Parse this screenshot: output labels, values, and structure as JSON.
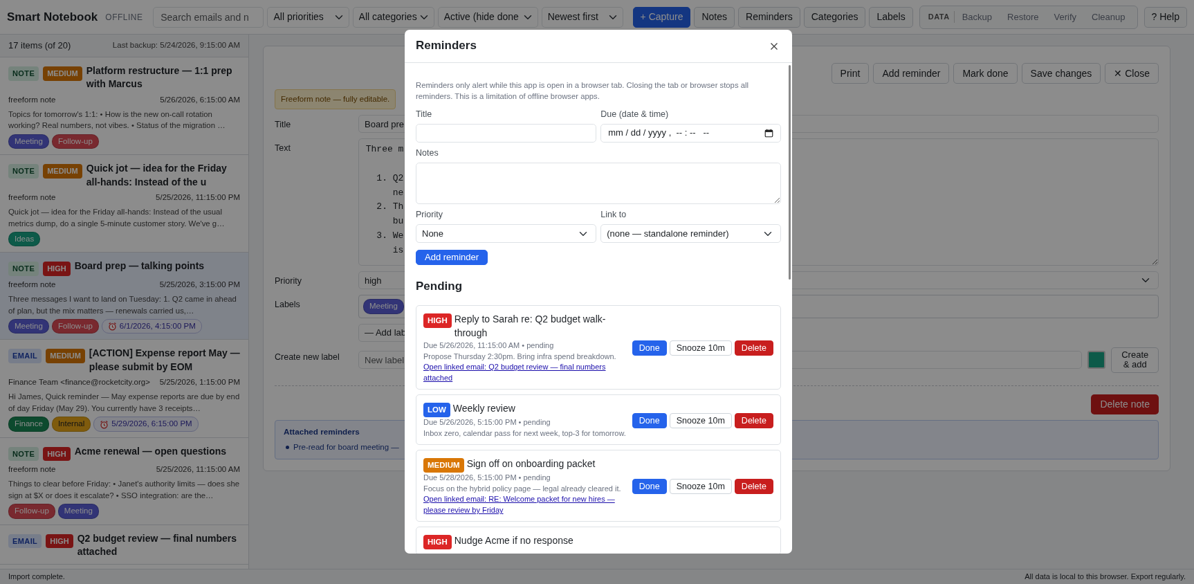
{
  "app": {
    "title": "Smart Notebook",
    "badge": "OFFLINE"
  },
  "toolbar": {
    "search": {
      "placeholder": "Search emails and n"
    },
    "filters": [
      "All priorities",
      "All categories",
      "Active (hide done",
      "Newest first"
    ],
    "buttons": [
      {
        "label": "+ Capture",
        "kind": "primary"
      },
      {
        "label": "Notes",
        "kind": "plain"
      },
      {
        "label": "Reminders",
        "kind": "plain"
      },
      {
        "label": "Categories",
        "kind": "plain"
      },
      {
        "label": "Labels",
        "kind": "plain"
      }
    ],
    "data_group": {
      "label": "DATA",
      "buttons": [
        "Backup",
        "Restore",
        "Verify",
        "Cleanup"
      ]
    },
    "help": "? Help"
  },
  "list": {
    "count": "17 items (of 20)",
    "backup": "Last backup: 5/24/2026, 9:15:00 AM",
    "items": [
      {
        "type": {
          "kind": "note",
          "label": "NOTE"
        },
        "priority": {
          "kind": "medium",
          "label": "MEDIUM"
        },
        "title": "Platform restructure — 1:1 prep with Marcus",
        "source": "freeform note",
        "date": "5/26/2026, 6:15:00 AM",
        "snippet": "Topics for tomorrow's 1:1: • How is the new on-call rotation working? Real numbers, not vibes. • Status of the migration …",
        "tags": [
          {
            "label": "Meeting",
            "color": "#323476"
          },
          {
            "label": "Follow-up",
            "color": "#792930"
          }
        ],
        "selected": false
      },
      {
        "type": {
          "kind": "note",
          "label": "NOTE"
        },
        "priority": {
          "kind": "medium",
          "label": "MEDIUM"
        },
        "title": "Quick jot — idea for the Friday all-hands: Instead of the u",
        "source": "freeform note",
        "date": "5/25/2026, 11:15:00 PM",
        "snippet": "Quick jot — idea for the Friday all-hands: Instead of the usual metrics dump, do a single 5-minute customer story. We've g…",
        "tags": [
          {
            "label": "Ideas",
            "color": "#0e5a49"
          }
        ],
        "selected": false
      },
      {
        "type": {
          "kind": "note",
          "label": "NOTE"
        },
        "priority": {
          "kind": "high",
          "label": "HIGH"
        },
        "title": "Board prep — talking points",
        "source": "freeform note",
        "date": "5/25/2026, 3:15:00 PM",
        "snippet": "Three messages I want to land on Tuesday: 1. Q2 came in ahead of plan, but the mix matters — renewals carried us,…",
        "tags": [
          {
            "label": "Meeting",
            "color": "#323476"
          },
          {
            "label": "Follow-up",
            "color": "#792930"
          }
        ],
        "reminder": "6/1/2026, 4:15:00 PM",
        "selected": true
      },
      {
        "type": {
          "kind": "email",
          "label": "EMAIL"
        },
        "priority": {
          "kind": "medium",
          "label": "MEDIUM"
        },
        "title": "[ACTION] Expense report May — please submit by EOM",
        "source": "Finance Team <finance@rocketcity.org>",
        "date": "5/25/2026, 1:15:00 PM",
        "snippet": "Hi James, Quick reminder — May expense reports are due by end of day Friday (May 29). You currently have 3 receipts…",
        "tags": [
          {
            "label": "Finance",
            "color": "#0e4a2e"
          },
          {
            "label": "Internal",
            "color": "#7f5c0d"
          }
        ],
        "reminder": "5/29/2026, 6:15:00 PM",
        "selected": false
      },
      {
        "type": {
          "kind": "note",
          "label": "NOTE"
        },
        "priority": {
          "kind": "high",
          "label": "HIGH"
        },
        "title": "Acme renewal — open questions",
        "source": "freeform note",
        "date": "5/25/2026, 11:15:00 AM",
        "snippet": "Things to clear before Friday: • Janet's authority limits — does she sign at $X or does it escalate? • SSO integration: are the…",
        "tags": [
          {
            "label": "Follow-up",
            "color": "#792930"
          },
          {
            "label": "Meeting",
            "color": "#323476"
          }
        ],
        "selected": false
      },
      {
        "type": {
          "kind": "email",
          "label": "EMAIL"
        },
        "priority": {
          "kind": "high",
          "label": "HIGH"
        },
        "title": "Q2 budget review — final numbers attached",
        "selected": false
      }
    ]
  },
  "editor": {
    "buttons": [
      "Print",
      "Add reminder",
      "Mark done",
      "Save changes",
      "✕ Close"
    ],
    "notice": "Freeform note — fully editable.",
    "fields": [
      {
        "kind": "input",
        "label": "Title",
        "value": "Board pre"
      },
      {
        "kind": "textarea",
        "label": "Text",
        "value": "Three m\n\n  1. Q2\n     ne\n  2. Th\n     bu\n  3. We\n     is"
      },
      {
        "kind": "select",
        "label": "Priority",
        "value": "high"
      },
      {
        "kind": "labels",
        "label": "Labels",
        "chips": [
          {
            "label": "Meeting",
            "color": "#323476"
          }
        ],
        "add": "— Add lab"
      },
      {
        "kind": "new_label",
        "label": "Create new label",
        "placeholder": "New label",
        "color": "#0e5a49",
        "button": "Create & add"
      }
    ],
    "delete": "Delete note",
    "attached": {
      "title": "Attached reminders",
      "items": [
        "Pre-read for board meeting —"
      ]
    }
  },
  "modal": {
    "title": "Reminders",
    "note": "Reminders only alert while this app is open in a browser tab. Closing the tab or browser stops all reminders. This is a limitation of offline browser apps.",
    "form": {
      "title_label": "Title",
      "due_label": "Due (date & time)",
      "due_placeholder": "mm / dd / yyyy ,  -- : --   --",
      "notes_label": "Notes",
      "priority_label": "Priority",
      "priority_value": "None",
      "link_label": "Link to",
      "link_value": "(none — standalone reminder)",
      "submit": "Add reminder"
    },
    "section": "Pending",
    "reminders": [
      {
        "priority": {
          "kind": "high",
          "label": "HIGH"
        },
        "title": "Reply to Sarah re: Q2 budget walk-through",
        "due": "Due 5/26/2026, 11:15:00 AM • pending",
        "notes": "Propose Thursday 2:30pm. Bring infra spend breakdown.",
        "link": "Open linked email: Q2 budget review — final numbers attached",
        "actions": [
          "Done",
          "Snooze 10m",
          "Delete"
        ]
      },
      {
        "priority": {
          "kind": "low",
          "label": "LOW"
        },
        "title": "Weekly review",
        "due": "Due 5/26/2026, 5:15:00 PM • pending",
        "notes": "Inbox zero, calendar pass for next week, top-3 for tomorrow.",
        "actions": [
          "Done",
          "Snooze 10m",
          "Delete"
        ]
      },
      {
        "priority": {
          "kind": "medium",
          "label": "MEDIUM"
        },
        "title": "Sign off on onboarding packet",
        "due": "Due 5/28/2026, 5:15:00 PM • pending",
        "notes": "Focus on the hybrid policy page — legal already cleared it.",
        "link": "Open linked email: RE: Welcome packet for new hires — please review by Friday",
        "actions": [
          "Done",
          "Snooze 10m",
          "Delete"
        ]
      },
      {
        "priority": {
          "kind": "high",
          "label": "HIGH"
        },
        "title": "Nudge Acme if no response"
      }
    ]
  },
  "status_bar": {
    "left": "Import complete.",
    "right": "All data is local to this browser. Export regularly."
  }
}
